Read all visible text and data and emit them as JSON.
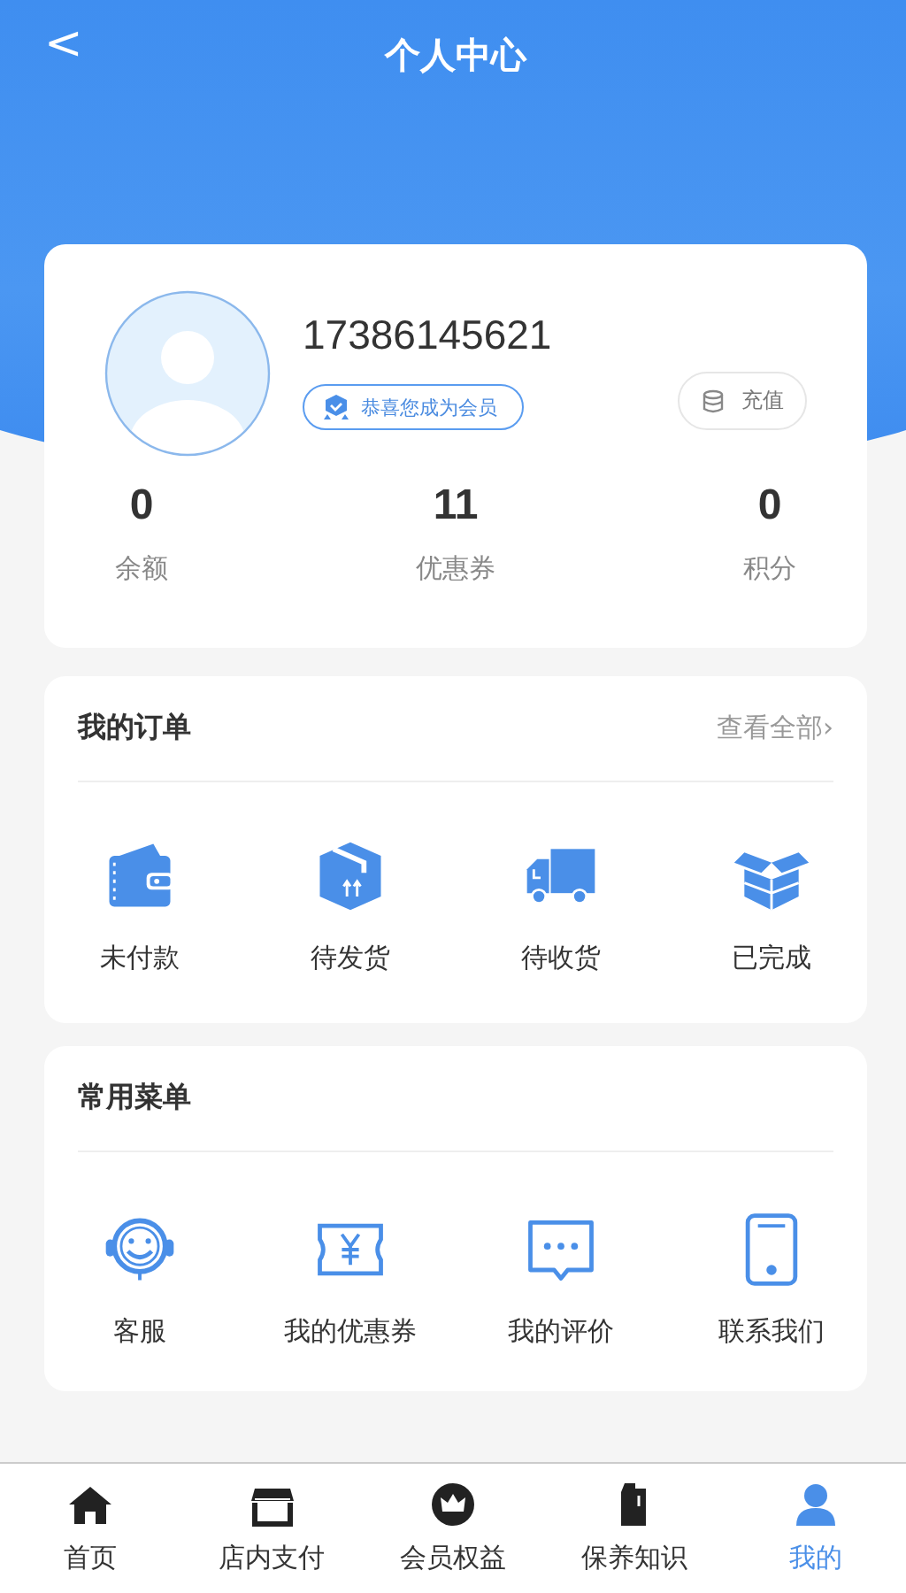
{
  "header": {
    "back": "<",
    "title": "个人中心"
  },
  "profile": {
    "phone": "17386145621",
    "member_badge": "恭喜您成为会员",
    "recharge": "充值",
    "stats": [
      {
        "value": "0",
        "label": "余额"
      },
      {
        "value": "11",
        "label": "优惠券"
      },
      {
        "value": "0",
        "label": "积分"
      }
    ]
  },
  "orders": {
    "title": "我的订单",
    "view_all": "查看全部",
    "chevron": "›",
    "items": [
      {
        "kind": "wallet",
        "label": "未付款"
      },
      {
        "kind": "package",
        "label": "待发货"
      },
      {
        "kind": "truck",
        "label": "待收货"
      },
      {
        "kind": "openbox",
        "label": "已完成"
      }
    ]
  },
  "menu": {
    "title": "常用菜单",
    "items": [
      {
        "kind": "support",
        "label": "客服"
      },
      {
        "kind": "coupon",
        "label": "我的优惠券"
      },
      {
        "kind": "comment",
        "label": "我的评价"
      },
      {
        "kind": "phone",
        "label": "联系我们"
      }
    ]
  },
  "tab_bar": [
    {
      "kind": "home",
      "label": "首页",
      "selected": false
    },
    {
      "kind": "store",
      "label": "店内支付",
      "selected": false
    },
    {
      "kind": "crown",
      "label": "会员权益",
      "selected": false
    },
    {
      "kind": "bottle",
      "label": "保养知识",
      "selected": false
    },
    {
      "kind": "user",
      "label": "我的",
      "selected": true
    }
  ]
}
